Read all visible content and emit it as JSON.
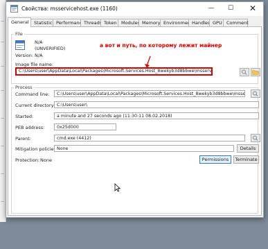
{
  "window": {
    "title": "Свойства: msservicehost.exe (1160)",
    "controls": {
      "minimize": "—",
      "maximize": "☐",
      "close": "✕"
    }
  },
  "tabs": [
    "General",
    "Statistics",
    "Performance",
    "Threads",
    "Token",
    "Modules",
    "Memory",
    "Environment",
    "Handles",
    "GPU",
    "Comment"
  ],
  "file": {
    "group_label": "File",
    "name": "N/A",
    "status": "(UNVERIFIED)",
    "version_label": "Version:",
    "version_value": "N/A",
    "image_label": "Image file name:",
    "image_path": "C:\\Users\\user\\AppData\\Local\\Packages\\Microsoft.Services.Host_8wekyb3d8bbwe\\msservicehost.exe"
  },
  "annotation": "а вот и путь, по которому лежит майнер",
  "process": {
    "group_label": "Process",
    "command_line_label": "Command line:",
    "command_line": "C:\\Users\\user\\AppData\\Local\\Packages\\Microsoft.Services.Host_8wekyb3d8bbwe\\msservicehost.exe",
    "current_dir_label": "Current directory:",
    "current_dir": "C:\\Users\\user\\",
    "started_label": "Started:",
    "started": "a minute and 27 seconds ago (11:30:11 08.02.2018)",
    "peb_label": "PEB address:",
    "peb": "0x25d000",
    "parent_label": "Parent:",
    "parent": "cmd.exe (4412)",
    "mitigation_label": "Mitigation policies:",
    "mitigation": "None",
    "details_btn": "Details",
    "protection_label": "Protection:",
    "protection": "None",
    "permissions_btn": "Permissions",
    "terminate_btn": "Terminate"
  },
  "colors": {
    "accent": "#d90000",
    "annotation": "#e00000",
    "primary_button_border": "#2f7ad1"
  }
}
